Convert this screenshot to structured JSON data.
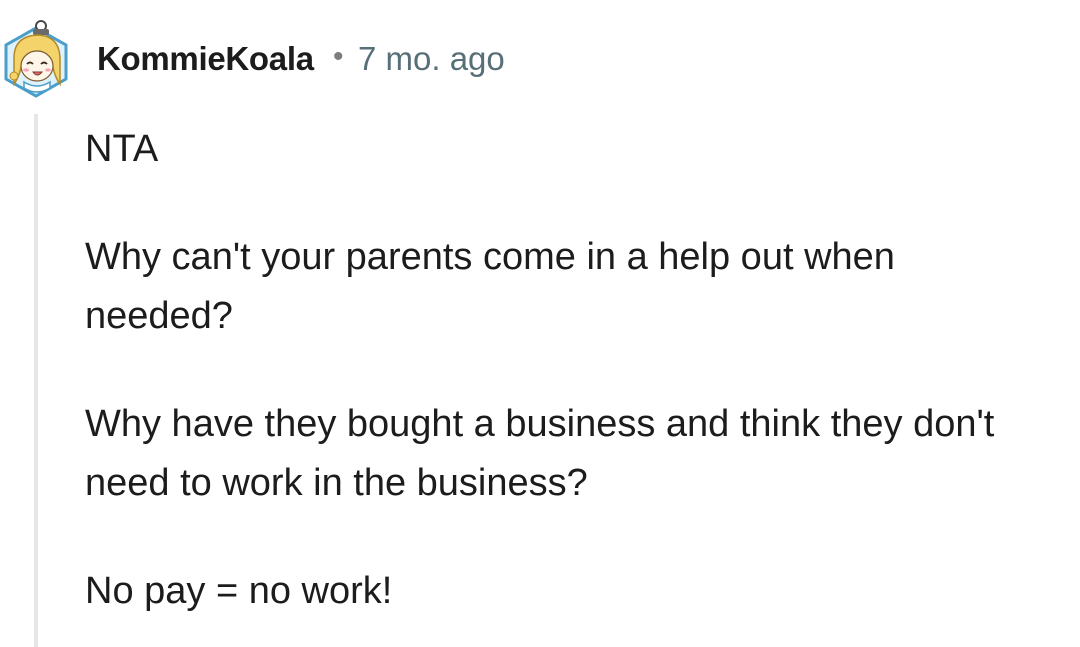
{
  "comment": {
    "author": "KommieKoala",
    "separator": "•",
    "time_ago": "7 mo. ago",
    "avatar_icon": "koala-avatar-icon",
    "paragraphs": [
      "NTA",
      "Why can't your parents come in a help out when needed?",
      "Why have they bought a business and think they don't need to work in the business?",
      "No pay = no work!"
    ]
  },
  "colors": {
    "username": "#1c1c1c",
    "timestamp": "#576f76",
    "thread_line": "#e4e6e8",
    "avatar_border": "#4a9ec9",
    "avatar_hair": "#f3d36a"
  }
}
